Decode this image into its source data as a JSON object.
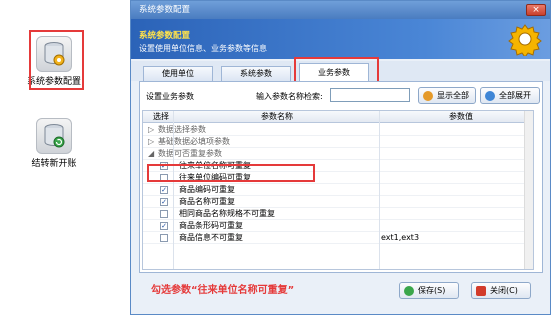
{
  "sidebar": {
    "items": [
      {
        "label": "系统参数配置",
        "icon": "database-gear-icon"
      },
      {
        "label": "结转新开账",
        "icon": "database-refresh-icon"
      }
    ]
  },
  "window": {
    "title": "系统参数配置",
    "close": "×",
    "banner_title": "系统参数配置",
    "banner_subtitle": "设置使用单位信息、业务参数等信息"
  },
  "tabs": [
    "使用单位",
    "系统参数",
    "业务参数"
  ],
  "active_tab": "业务参数",
  "toolbar": {
    "section_label": "设置业务参数",
    "search_label": "输入参数名称检索:",
    "search_value": "",
    "show_all": "显示全部",
    "expand_all": "全部展开"
  },
  "grid": {
    "headers": [
      "选择",
      "参数名称",
      "参数值"
    ],
    "groups": [
      "数据选择参数",
      "基础数据必填项参数",
      "数据可否重复参数"
    ],
    "rows": [
      {
        "name": "往来单位名称可重复",
        "checked": true,
        "value": ""
      },
      {
        "name": "往来单位编码可重复",
        "checked": false,
        "value": ""
      },
      {
        "name": "商品编码可重复",
        "checked": true,
        "value": ""
      },
      {
        "name": "商品名称可重复",
        "checked": true,
        "value": ""
      },
      {
        "name": "相同商品名称规格不可重复",
        "checked": false,
        "value": ""
      },
      {
        "name": "商品条形码可重复",
        "checked": true,
        "value": ""
      },
      {
        "name": "商品信息不可重复",
        "checked": false,
        "value": "ext1,ext3"
      }
    ]
  },
  "footer": {
    "note": "勾选参数“往来单位名称可重复”",
    "save": "保存(S)",
    "close": "关闭(C)"
  },
  "colors": {
    "highlight": "#e53a3a",
    "banner": "#2b63b8",
    "banner_title": "#ffe24a"
  }
}
